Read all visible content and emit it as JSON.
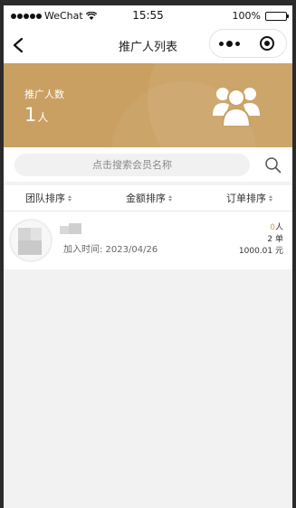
{
  "status_bar": {
    "carrier": "WeChat",
    "time": "15:55",
    "battery": "100%"
  },
  "nav": {
    "title": "推广人列表",
    "icons": [
      "back-icon",
      "more-icon",
      "close-icon"
    ]
  },
  "banner": {
    "label": "推广人数",
    "count": "1",
    "unit": "人",
    "icon": "team-icon",
    "color": "#c9a062"
  },
  "search": {
    "placeholder": "点击搜索会员名称",
    "icon": "search-icon"
  },
  "sort": {
    "items": [
      {
        "label": "团队排序"
      },
      {
        "label": "金额排序"
      },
      {
        "label": "订单排序"
      }
    ]
  },
  "members": [
    {
      "join_label": "加入时间: 2023/04/26",
      "team_count": "0",
      "team_unit": "人",
      "orders": "2",
      "orders_unit": "单",
      "amount": "1000.01",
      "amount_unit": "元"
    }
  ],
  "colors": {
    "accent": "#c9a062",
    "page_bg": "#f2f2f2"
  }
}
